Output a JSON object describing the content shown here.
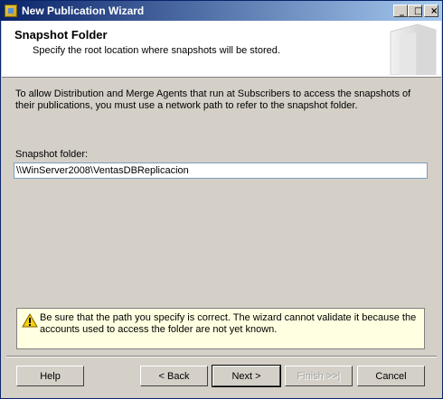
{
  "window": {
    "title": "New Publication Wizard"
  },
  "title_buttons": {
    "minimize": "_",
    "maximize": "□",
    "close": "×"
  },
  "header": {
    "title": "Snapshot Folder",
    "subtitle": "Specify the root location where snapshots will be stored."
  },
  "content": {
    "intro": "To allow Distribution and Merge Agents that run at Subscribers to access the snapshots of their publications, you must use a network path to refer to the snapshot folder.",
    "folder_label": "Snapshot folder:",
    "folder_value": "\\\\WinServer2008\\VentasDBReplicacion"
  },
  "warning": {
    "text": "Be sure that the path you specify is correct. The wizard cannot validate it because the accounts used to access the folder are not yet known.",
    "icon": "warning-icon"
  },
  "buttons": {
    "help": "Help",
    "back": "< Back",
    "next": "Next >",
    "finish": "Finish >>|",
    "cancel": "Cancel"
  }
}
